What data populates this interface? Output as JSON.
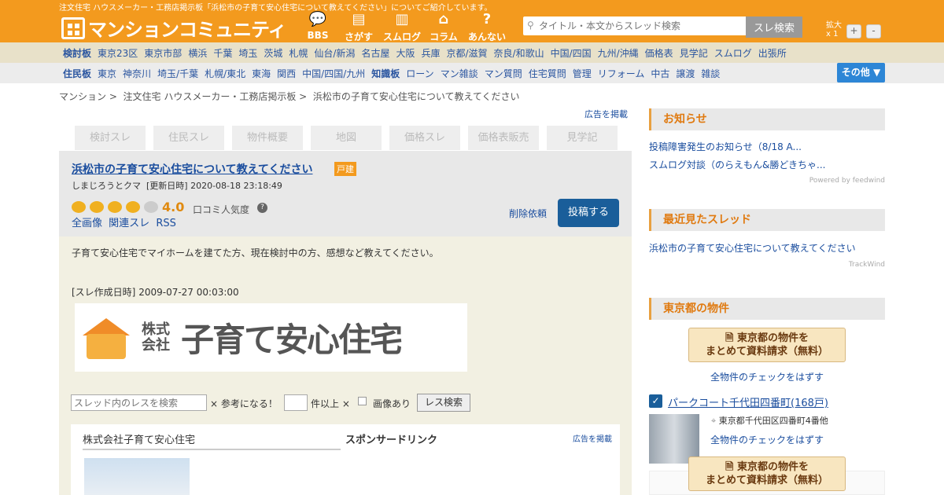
{
  "top_note": "注文住宅 ハウスメーカー・工務店掲示板「浜松市の子育て安心住宅について教えてください」についてご紹介しています。",
  "logo_text": "マンションコミュニティ",
  "nav": [
    {
      "label": "BBS",
      "icon": "speech-bubble-icon"
    },
    {
      "label": "さがす",
      "icon": "building-icon"
    },
    {
      "label": "スムログ",
      "icon": "apartment-icon"
    },
    {
      "label": "コラム",
      "icon": "house-icon"
    },
    {
      "label": "あんない",
      "icon": "question-icon"
    }
  ],
  "search": {
    "placeholder": "タイトル・本文からスレッド検索",
    "button": "スレ検索"
  },
  "zoom": {
    "label": "拡大",
    "value": "x 1",
    "plus": "+",
    "minus": "-"
  },
  "cat1": [
    "検討板",
    "東京23区",
    "東京市部",
    "横浜",
    "千葉",
    "埼玉",
    "茨城",
    "札幌",
    "仙台/新潟",
    "名古屋",
    "大阪",
    "兵庫",
    "京都/滋賀",
    "奈良/和歌山",
    "中国/四国",
    "九州/沖縄",
    "価格表",
    "見学記",
    "スムログ",
    "出張所"
  ],
  "cat2": [
    "住民板",
    "東京",
    "神奈川",
    "埼玉/千葉",
    "札幌/東北",
    "東海",
    "関西",
    "中国/四国/九州",
    "知識板",
    "ローン",
    "マン雑談",
    "マン質問",
    "住宅質問",
    "管理",
    "リフォーム",
    "中古",
    "譲渡",
    "雑談"
  ],
  "other_button": "その他 ▼",
  "breadcrumb": [
    "マンション",
    "注文住宅 ハウスメーカー・工務店掲示板",
    "浜松市の子育て安心住宅について教えてください"
  ],
  "ad_link": "広告を掲載",
  "tabs": [
    "検討スレ",
    "住民スレ",
    "物件概要",
    "地図",
    "価格スレ",
    "価格表販売",
    "見学記"
  ],
  "thread": {
    "title": "浜松市の子育て安心住宅について教えてください",
    "badge": "戸建",
    "author": "しまじろうとクマ",
    "updated": "[更新日時] 2020-08-18 23:18:49",
    "rating": "4.0",
    "popularity_label": "口コミ人気度",
    "links": [
      "全画像",
      "関連スレ",
      "RSS"
    ],
    "delete_request": "削除依頼",
    "post_button": "投稿する",
    "body": "子育て安心住宅でマイホームを建てた方、現在検討中の方、感想など教えてください。",
    "created_label": "[スレ作成日時]",
    "created": "2009-07-27 00:03:00"
  },
  "banner": {
    "company_prefix": "株式会社",
    "company_name": "子育て安心住宅"
  },
  "res_search": {
    "placeholder": "スレッド内のレスを検索",
    "label1": "× 参考になる！",
    "label2": "件以上 ×",
    "label3": "画像あり",
    "button": "レス検索"
  },
  "sponsor": {
    "name": "株式会社子育て安心住宅",
    "label": "スポンサードリンク",
    "ad_link": "広告を掲載"
  },
  "sidebar": {
    "notice_title": "お知らせ",
    "notices": [
      "投稿障害発生のお知らせ（8/18 A...",
      "スムログ対談（のらえもん&勝どきちゃ..."
    ],
    "powered": "Powered by feedwind",
    "recent_title": "最近見たスレッド",
    "recent": [
      "浜松市の子育て安心住宅について教えてください"
    ],
    "trackwind": "TrackWind",
    "tokyo_title": "東京都の物件",
    "request_line1": "東京都の物件を",
    "request_line2": "まとめて資料請求（無料）",
    "uncheck_all": "全物件のチェックをはずす",
    "property_name": "パークコート千代田四番町(168戸)",
    "property_address": "東京都千代田区四番町4番他",
    "check_mark": "✓"
  }
}
